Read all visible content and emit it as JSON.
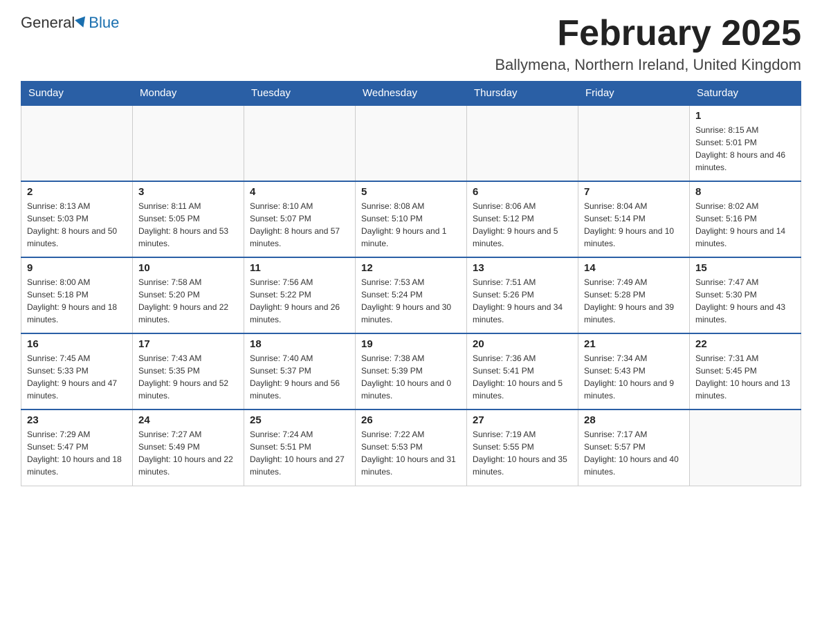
{
  "header": {
    "logo_general": "General",
    "logo_blue": "Blue",
    "month_title": "February 2025",
    "location": "Ballymena, Northern Ireland, United Kingdom"
  },
  "weekdays": [
    "Sunday",
    "Monday",
    "Tuesday",
    "Wednesday",
    "Thursday",
    "Friday",
    "Saturday"
  ],
  "weeks": [
    [
      {
        "day": "",
        "info": ""
      },
      {
        "day": "",
        "info": ""
      },
      {
        "day": "",
        "info": ""
      },
      {
        "day": "",
        "info": ""
      },
      {
        "day": "",
        "info": ""
      },
      {
        "day": "",
        "info": ""
      },
      {
        "day": "1",
        "info": "Sunrise: 8:15 AM\nSunset: 5:01 PM\nDaylight: 8 hours and 46 minutes."
      }
    ],
    [
      {
        "day": "2",
        "info": "Sunrise: 8:13 AM\nSunset: 5:03 PM\nDaylight: 8 hours and 50 minutes."
      },
      {
        "day": "3",
        "info": "Sunrise: 8:11 AM\nSunset: 5:05 PM\nDaylight: 8 hours and 53 minutes."
      },
      {
        "day": "4",
        "info": "Sunrise: 8:10 AM\nSunset: 5:07 PM\nDaylight: 8 hours and 57 minutes."
      },
      {
        "day": "5",
        "info": "Sunrise: 8:08 AM\nSunset: 5:10 PM\nDaylight: 9 hours and 1 minute."
      },
      {
        "day": "6",
        "info": "Sunrise: 8:06 AM\nSunset: 5:12 PM\nDaylight: 9 hours and 5 minutes."
      },
      {
        "day": "7",
        "info": "Sunrise: 8:04 AM\nSunset: 5:14 PM\nDaylight: 9 hours and 10 minutes."
      },
      {
        "day": "8",
        "info": "Sunrise: 8:02 AM\nSunset: 5:16 PM\nDaylight: 9 hours and 14 minutes."
      }
    ],
    [
      {
        "day": "9",
        "info": "Sunrise: 8:00 AM\nSunset: 5:18 PM\nDaylight: 9 hours and 18 minutes."
      },
      {
        "day": "10",
        "info": "Sunrise: 7:58 AM\nSunset: 5:20 PM\nDaylight: 9 hours and 22 minutes."
      },
      {
        "day": "11",
        "info": "Sunrise: 7:56 AM\nSunset: 5:22 PM\nDaylight: 9 hours and 26 minutes."
      },
      {
        "day": "12",
        "info": "Sunrise: 7:53 AM\nSunset: 5:24 PM\nDaylight: 9 hours and 30 minutes."
      },
      {
        "day": "13",
        "info": "Sunrise: 7:51 AM\nSunset: 5:26 PM\nDaylight: 9 hours and 34 minutes."
      },
      {
        "day": "14",
        "info": "Sunrise: 7:49 AM\nSunset: 5:28 PM\nDaylight: 9 hours and 39 minutes."
      },
      {
        "day": "15",
        "info": "Sunrise: 7:47 AM\nSunset: 5:30 PM\nDaylight: 9 hours and 43 minutes."
      }
    ],
    [
      {
        "day": "16",
        "info": "Sunrise: 7:45 AM\nSunset: 5:33 PM\nDaylight: 9 hours and 47 minutes."
      },
      {
        "day": "17",
        "info": "Sunrise: 7:43 AM\nSunset: 5:35 PM\nDaylight: 9 hours and 52 minutes."
      },
      {
        "day": "18",
        "info": "Sunrise: 7:40 AM\nSunset: 5:37 PM\nDaylight: 9 hours and 56 minutes."
      },
      {
        "day": "19",
        "info": "Sunrise: 7:38 AM\nSunset: 5:39 PM\nDaylight: 10 hours and 0 minutes."
      },
      {
        "day": "20",
        "info": "Sunrise: 7:36 AM\nSunset: 5:41 PM\nDaylight: 10 hours and 5 minutes."
      },
      {
        "day": "21",
        "info": "Sunrise: 7:34 AM\nSunset: 5:43 PM\nDaylight: 10 hours and 9 minutes."
      },
      {
        "day": "22",
        "info": "Sunrise: 7:31 AM\nSunset: 5:45 PM\nDaylight: 10 hours and 13 minutes."
      }
    ],
    [
      {
        "day": "23",
        "info": "Sunrise: 7:29 AM\nSunset: 5:47 PM\nDaylight: 10 hours and 18 minutes."
      },
      {
        "day": "24",
        "info": "Sunrise: 7:27 AM\nSunset: 5:49 PM\nDaylight: 10 hours and 22 minutes."
      },
      {
        "day": "25",
        "info": "Sunrise: 7:24 AM\nSunset: 5:51 PM\nDaylight: 10 hours and 27 minutes."
      },
      {
        "day": "26",
        "info": "Sunrise: 7:22 AM\nSunset: 5:53 PM\nDaylight: 10 hours and 31 minutes."
      },
      {
        "day": "27",
        "info": "Sunrise: 7:19 AM\nSunset: 5:55 PM\nDaylight: 10 hours and 35 minutes."
      },
      {
        "day": "28",
        "info": "Sunrise: 7:17 AM\nSunset: 5:57 PM\nDaylight: 10 hours and 40 minutes."
      },
      {
        "day": "",
        "info": ""
      }
    ]
  ]
}
